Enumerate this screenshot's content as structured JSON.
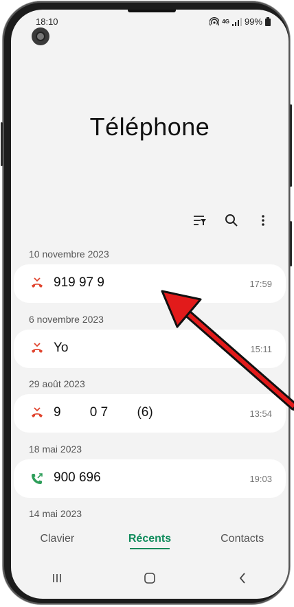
{
  "status": {
    "time": "18:10",
    "network": "4G",
    "battery": "99%"
  },
  "header": {
    "title": "Téléphone"
  },
  "calls": [
    {
      "date": "10 novembre 2023",
      "name": "919 97 9",
      "time": "17:59",
      "type": "missed"
    },
    {
      "date": "6 novembre 2023",
      "name": "Yo",
      "time": "15:11",
      "type": "missed"
    },
    {
      "date": "29 août 2023",
      "name": "9        0 7        (6)",
      "time": "13:54",
      "type": "missed"
    },
    {
      "date": "18 mai 2023",
      "name": "900 696",
      "time": "19:03",
      "type": "outgoing"
    }
  ],
  "extra_date": "14 mai 2023",
  "tabs": {
    "keypad": "Clavier",
    "recents": "Récents",
    "contacts": "Contacts"
  },
  "colors": {
    "accent": "#0d8a5a",
    "missed": "#e0442e",
    "outgoing": "#2e9e5a",
    "annotation_arrow": "#e21b1b"
  }
}
